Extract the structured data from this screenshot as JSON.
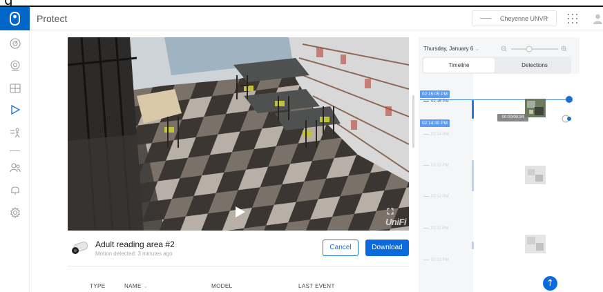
{
  "top_fragment": "g",
  "app": {
    "title": "Protect"
  },
  "console": {
    "name": "Cheyenne UNVR",
    "chevron": "⌄"
  },
  "sidebar": {
    "items": [
      {
        "icon": "dashboard-icon"
      },
      {
        "icon": "devices-icon"
      },
      {
        "icon": "liveview-grid-icon"
      },
      {
        "icon": "play-timeline-icon",
        "active": true
      },
      {
        "icon": "detections-icon"
      },
      {
        "icon": "users-icon"
      },
      {
        "icon": "bell-alerts-icon"
      },
      {
        "icon": "gear-settings-icon"
      }
    ]
  },
  "camera": {
    "name": "Adult reading area #2",
    "status": "Motion detected: 3 minutes ago",
    "watermark": "UniFi"
  },
  "actions": {
    "cancel": "Cancel",
    "download": "Download"
  },
  "table": {
    "headers": [
      {
        "label": "TYPE",
        "caret": ""
      },
      {
        "label": "NAME",
        "caret": "⌄"
      },
      {
        "label": "MODEL",
        "caret": ""
      },
      {
        "label": "LAST EVENT",
        "caret": ""
      }
    ]
  },
  "timeline": {
    "date": "Thursday, January 6",
    "date_caret": "⌄",
    "tabs": {
      "timeline": "Timeline",
      "detections": "Detections"
    },
    "selection_start": "02:15:05 PM",
    "selection_end": "02:14:30 PM",
    "clip_duration": "00:00/00:34",
    "ticks": [
      "02:15 PM",
      "02:14 PM",
      "02:13 PM",
      "02:12 PM",
      "02:11 PM",
      "02:10 PM"
    ]
  },
  "colors": {
    "brand_blue": "#0066c8",
    "accent_blue": "#0a6bdc",
    "tag_blue": "#5d9cf0",
    "panel_bg": "#f5f6f8"
  }
}
